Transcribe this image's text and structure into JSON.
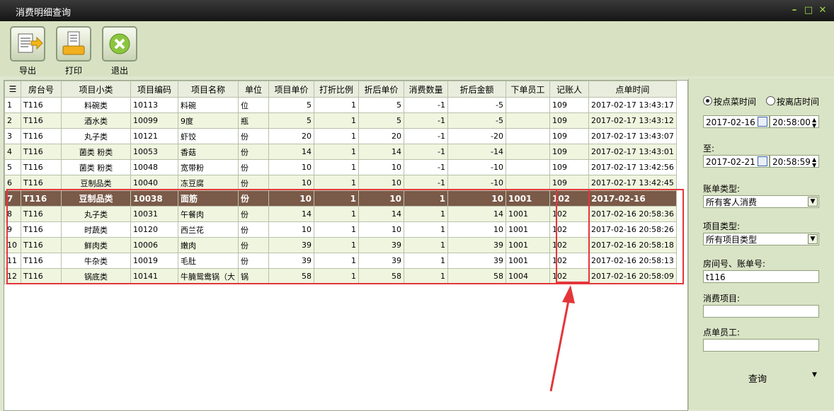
{
  "window": {
    "title": "消费明细查询",
    "controls": [
      "–",
      "□",
      "✕"
    ]
  },
  "toolbar": {
    "export_label": "导出",
    "print_label": "打印",
    "exit_label": "退出"
  },
  "table": {
    "columns": [
      "房台号",
      "项目小类",
      "项目编码",
      "项目名称",
      "单位",
      "项目单价",
      "打折比例",
      "折后单价",
      "消费数量",
      "折后金额",
      "下单员工",
      "记账人",
      "点单时间"
    ],
    "rows": [
      [
        "1",
        "T116",
        "料碗类",
        "10113",
        "料碗",
        "位",
        "5",
        "1",
        "5",
        "-1",
        "-5",
        "",
        "109",
        "2017-02-17 13:43:17"
      ],
      [
        "2",
        "T116",
        "酒水类",
        "10099",
        "9度",
        "瓶",
        "5",
        "1",
        "5",
        "-1",
        "-5",
        "",
        "109",
        "2017-02-17 13:43:12"
      ],
      [
        "3",
        "T116",
        "丸子类",
        "10121",
        "虾饺",
        "份",
        "20",
        "1",
        "20",
        "-1",
        "-20",
        "",
        "109",
        "2017-02-17 13:43:07"
      ],
      [
        "4",
        "T116",
        "菌类 粉类",
        "10053",
        "香菇",
        "份",
        "14",
        "1",
        "14",
        "-1",
        "-14",
        "",
        "109",
        "2017-02-17 13:43:01"
      ],
      [
        "5",
        "T116",
        "菌类 粉类",
        "10048",
        "宽带粉",
        "份",
        "10",
        "1",
        "10",
        "-1",
        "-10",
        "",
        "109",
        "2017-02-17 13:42:56"
      ],
      [
        "6",
        "T116",
        "豆制品类",
        "10040",
        "冻豆腐",
        "份",
        "10",
        "1",
        "10",
        "-1",
        "-10",
        "",
        "109",
        "2017-02-17 13:42:45"
      ],
      [
        "7",
        "T116",
        "豆制品类",
        "10038",
        "面筋",
        "份",
        "10",
        "1",
        "10",
        "1",
        "10",
        "1001",
        "102",
        "2017-02-16"
      ],
      [
        "8",
        "T116",
        "丸子类",
        "10031",
        "午餐肉",
        "份",
        "14",
        "1",
        "14",
        "1",
        "14",
        "1001",
        "102",
        "2017-02-16 20:58:36"
      ],
      [
        "9",
        "T116",
        "时蔬类",
        "10120",
        "西兰花",
        "份",
        "10",
        "1",
        "10",
        "1",
        "10",
        "1001",
        "102",
        "2017-02-16 20:58:26"
      ],
      [
        "10",
        "T116",
        "鲜肉类",
        "10006",
        "嫩肉",
        "份",
        "39",
        "1",
        "39",
        "1",
        "39",
        "1001",
        "102",
        "2017-02-16 20:58:18"
      ],
      [
        "11",
        "T116",
        "牛杂类",
        "10019",
        "毛肚",
        "份",
        "39",
        "1",
        "39",
        "1",
        "39",
        "1001",
        "102",
        "2017-02-16 20:58:13"
      ],
      [
        "12",
        "T116",
        "锅底类",
        "10141",
        "牛腩鸳鸯锅（大",
        "锅",
        "58",
        "1",
        "58",
        "1",
        "58",
        "1004",
        "102",
        "2017-02-16 20:58:09"
      ]
    ]
  },
  "filters": {
    "radio_order_time": "按点菜时间",
    "radio_leave_time": "按离店时间",
    "start_date": "2017-02-16",
    "start_time": "20:58:00",
    "to_label": "至:",
    "end_date": "2017-02-21",
    "end_time": "20:58:59",
    "bill_type_label": "账单类型:",
    "bill_type_value": "所有客人消费",
    "item_type_label": "项目类型:",
    "item_type_value": "所有项目类型",
    "room_label": "房间号、账单号:",
    "room_value": "t116",
    "item_label": "消费项目:",
    "item_value": "",
    "staff_label": "点单员工:",
    "staff_value": "",
    "query_label": "查询"
  },
  "colors": {
    "highlight": "#e4363a",
    "selected_row": "#7a5a48",
    "title_accent": "#9ed94a"
  }
}
